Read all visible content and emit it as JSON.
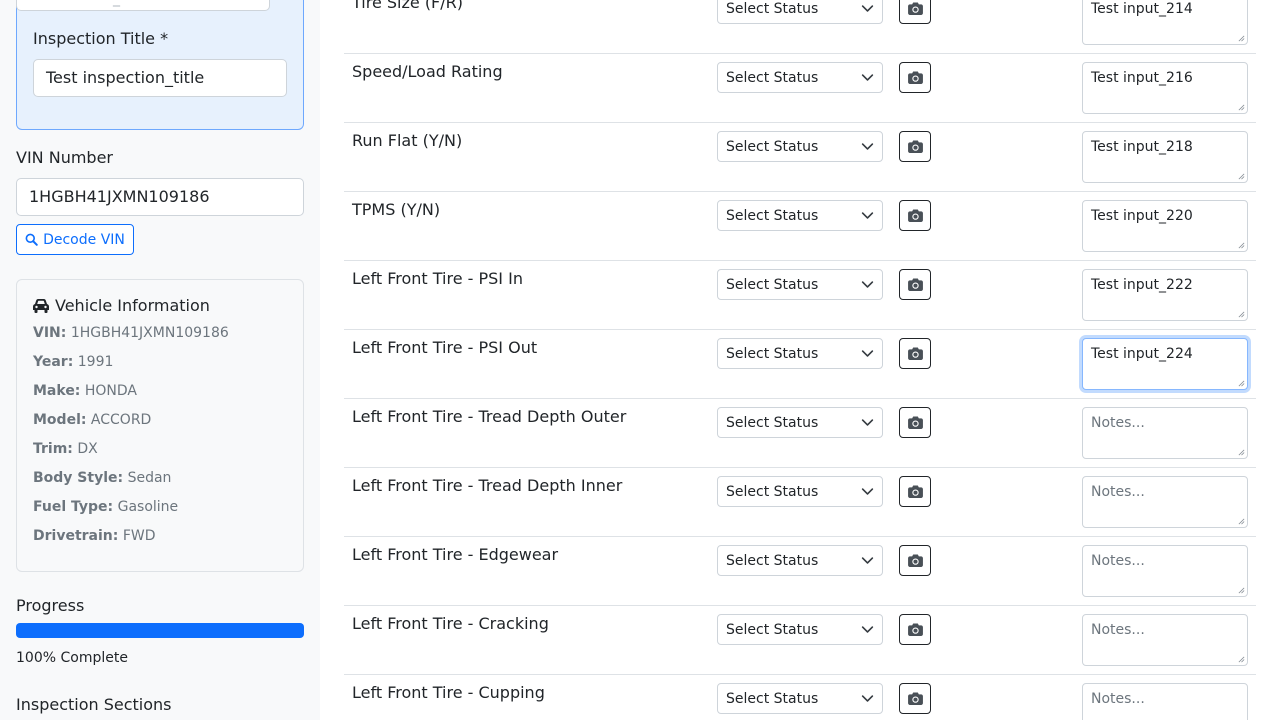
{
  "sidebar": {
    "inspection_title_label": "Inspection Title *",
    "inspection_title_value": "Test inspection_title",
    "vin_label": "VIN Number",
    "vin_value": "1HGBH41JXMN109186",
    "decode_button": "Decode VIN",
    "vehicle_info": {
      "title": "Vehicle Information",
      "fields": [
        {
          "key": "VIN:",
          "value": "1HGBH41JXMN109186"
        },
        {
          "key": "Year:",
          "value": "1991"
        },
        {
          "key": "Make:",
          "value": "HONDA"
        },
        {
          "key": "Model:",
          "value": "ACCORD"
        },
        {
          "key": "Trim:",
          "value": "DX"
        },
        {
          "key": "Body Style:",
          "value": "Sedan"
        },
        {
          "key": "Fuel Type:",
          "value": "Gasoline"
        },
        {
          "key": "Drivetrain:",
          "value": "FWD"
        }
      ]
    },
    "progress_label": "Progress",
    "progress_percent": 100,
    "progress_text": "100% Complete",
    "sections_label": "Inspection Sections"
  },
  "items": [
    {
      "label": "Tire Size (F/R)",
      "status": "Select Status",
      "notes_value": "Test input_214",
      "notes_placeholder": "Notes..."
    },
    {
      "label": "Speed/Load Rating",
      "status": "Select Status",
      "notes_value": "Test input_216",
      "notes_placeholder": "Notes..."
    },
    {
      "label": "Run Flat (Y/N)",
      "status": "Select Status",
      "notes_value": "Test input_218",
      "notes_placeholder": "Notes..."
    },
    {
      "label": "TPMS (Y/N)",
      "status": "Select Status",
      "notes_value": "Test input_220",
      "notes_placeholder": "Notes..."
    },
    {
      "label": "Left Front Tire - PSI In",
      "status": "Select Status",
      "notes_value": "Test input_222",
      "notes_placeholder": "Notes..."
    },
    {
      "label": "Left Front Tire - PSI Out",
      "status": "Select Status",
      "notes_value": "Test input_224",
      "notes_placeholder": "Notes...",
      "focused": true
    },
    {
      "label": "Left Front Tire - Tread Depth Outer",
      "status": "Select Status",
      "notes_value": "",
      "notes_placeholder": "Notes..."
    },
    {
      "label": "Left Front Tire - Tread Depth Inner",
      "status": "Select Status",
      "notes_value": "",
      "notes_placeholder": "Notes..."
    },
    {
      "label": "Left Front Tire - Edgewear",
      "status": "Select Status",
      "notes_value": "",
      "notes_placeholder": "Notes..."
    },
    {
      "label": "Left Front Tire - Cracking",
      "status": "Select Status",
      "notes_value": "",
      "notes_placeholder": "Notes..."
    },
    {
      "label": "Left Front Tire - Cupping",
      "status": "Select Status",
      "notes_value": "",
      "notes_placeholder": "Notes..."
    }
  ],
  "colors": {
    "accent": "#0d6efd",
    "card_bg": "#e7f1fd",
    "sidebar_bg": "#f8f9fa"
  },
  "icons": {
    "decode": "search-icon",
    "vehicle": "car-icon",
    "row_photo": "camera-icon",
    "select": "chevron-down-icon"
  }
}
